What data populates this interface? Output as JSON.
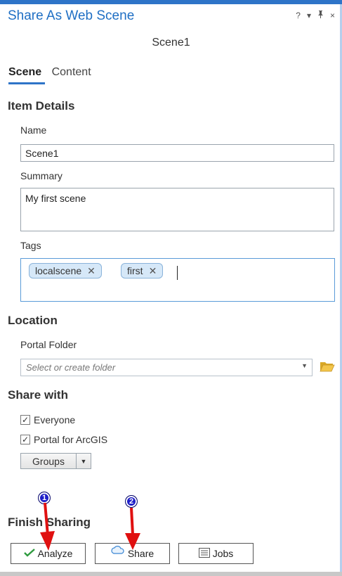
{
  "window": {
    "title": "Share As Web Scene",
    "help": "?",
    "menu": "▾",
    "pin": "ᵖ",
    "close": "×"
  },
  "scene_name": "Scene1",
  "tabs": [
    {
      "label": "Scene",
      "active": true
    },
    {
      "label": "Content",
      "active": false
    }
  ],
  "item_details": {
    "heading": "Item Details",
    "name_label": "Name",
    "name_value": "Scene1",
    "summary_label": "Summary",
    "summary_value": "My first scene",
    "tags_label": "Tags",
    "tags": [
      "localscene",
      "first"
    ]
  },
  "location": {
    "heading": "Location",
    "portal_folder_label": "Portal Folder",
    "portal_folder_placeholder": "Select or create folder"
  },
  "share_with": {
    "heading": "Share with",
    "everyone_label": "Everyone",
    "everyone_checked": true,
    "portal_label": "Portal for ArcGIS",
    "portal_checked": true,
    "groups_label": "Groups"
  },
  "finish": {
    "heading": "Finish Sharing",
    "analyze_label": "Analyze",
    "share_label": "Share",
    "jobs_label": "Jobs"
  },
  "annotations": {
    "badge_1": "1",
    "badge_2": "2",
    "arrow_color": "#e01010",
    "badge_color": "#1e1ec8"
  },
  "colors": {
    "accent": "#2e74c8",
    "title": "#1f6fc4",
    "analyze_check": "#2e9a3e",
    "cloud": "#3a86d4"
  }
}
